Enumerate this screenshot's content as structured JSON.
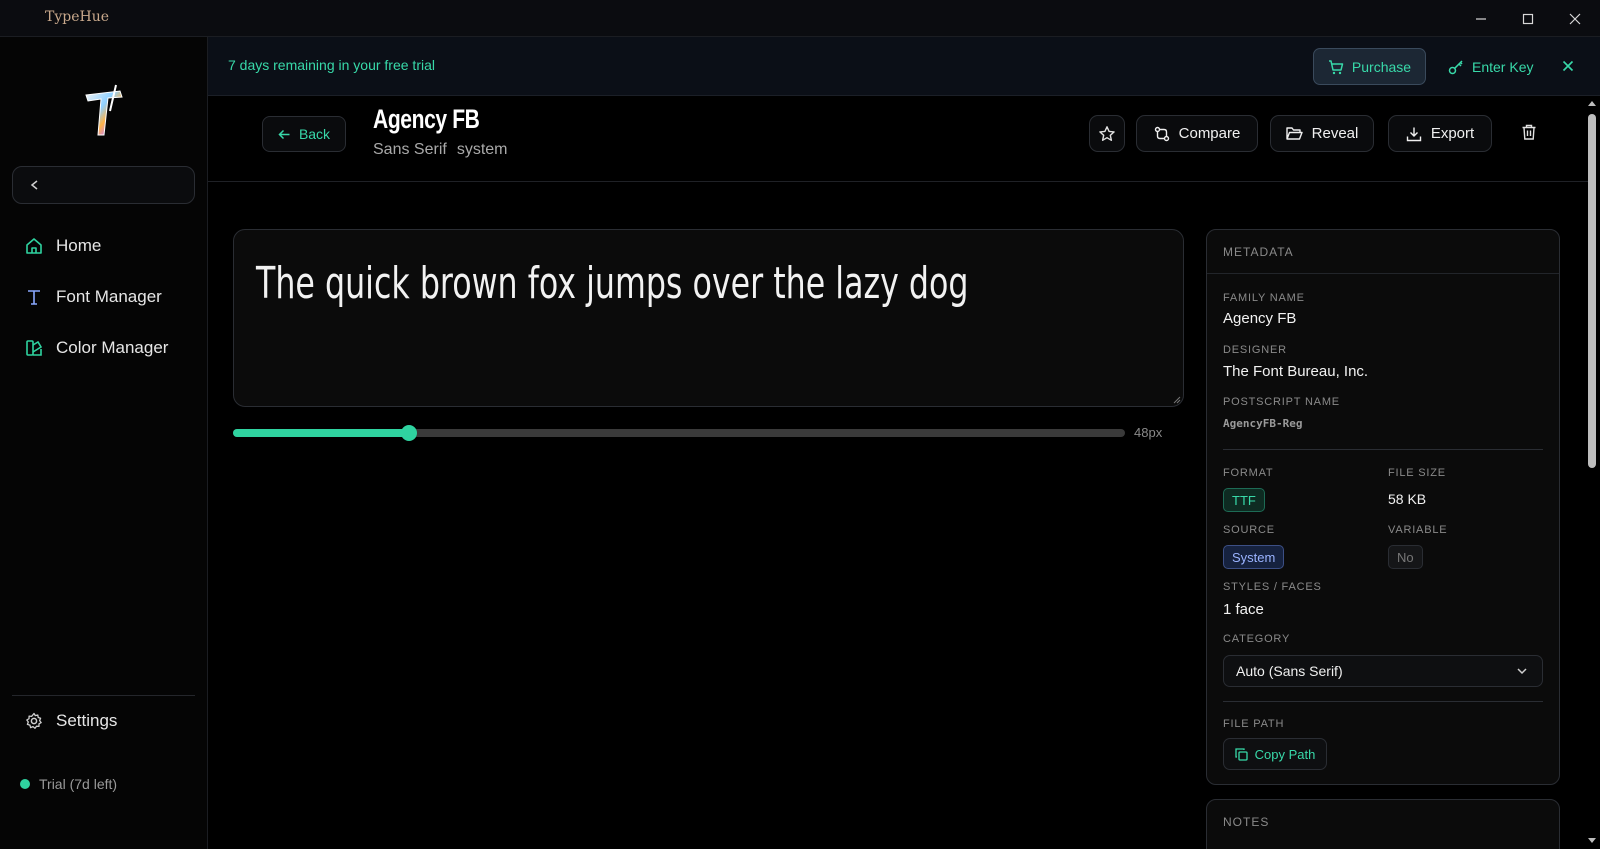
{
  "window": {
    "title": "TypeHue"
  },
  "sidebar": {
    "items": [
      {
        "label": "Home",
        "icon": "home-icon"
      },
      {
        "label": "Font Manager",
        "icon": "type-icon"
      },
      {
        "label": "Color Manager",
        "icon": "palette-icon"
      }
    ],
    "settings_label": "Settings",
    "trial_status": "Trial (7d left)"
  },
  "banner": {
    "text": "7 days remaining in your free trial",
    "purchase_label": "Purchase",
    "enter_key_label": "Enter Key"
  },
  "header": {
    "back_label": "Back",
    "font_name": "Agency FB",
    "category": "Sans Serif",
    "source": "system",
    "compare_label": "Compare",
    "reveal_label": "Reveal",
    "export_label": "Export"
  },
  "preview": {
    "text": "The quick brown fox jumps over the lazy dog",
    "size_label": "48px",
    "size_fraction": 0.197
  },
  "metadata": {
    "heading": "METADATA",
    "family_name_label": "FAMILY NAME",
    "family_name": "Agency FB",
    "designer_label": "DESIGNER",
    "designer": "The Font Bureau, Inc.",
    "postscript_label": "POSTSCRIPT NAME",
    "postscript": "AgencyFB-Reg",
    "format_label": "FORMAT",
    "format": "TTF",
    "file_size_label": "FILE SIZE",
    "file_size": "58 KB",
    "source_label": "SOURCE",
    "source": "System",
    "variable_label": "VARIABLE",
    "variable": "No",
    "styles_label": "STYLES / FACES",
    "styles": "1 face",
    "category_label": "CATEGORY",
    "category_value": "Auto (Sans Serif)",
    "file_path_label": "FILE PATH",
    "copy_path_label": "Copy Path"
  },
  "notes": {
    "heading": "NOTES"
  },
  "colors": {
    "accent": "#2fd3a0",
    "background": "#000000",
    "banner": "#0b0f17"
  }
}
